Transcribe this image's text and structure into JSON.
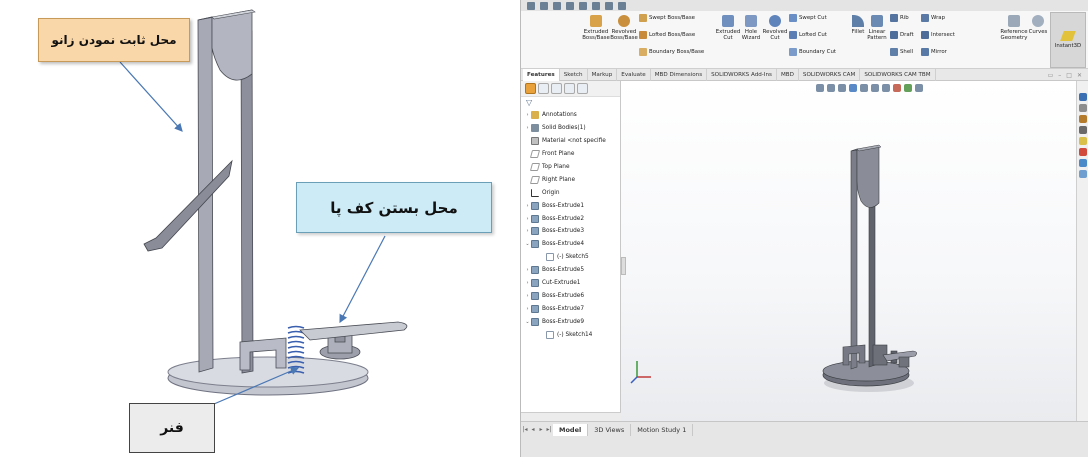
{
  "left_figure": {
    "callout_knee": "محل ثابت نمودن زانو",
    "callout_foot": "محل بستن کف پا",
    "callout_spring": "فنر"
  },
  "solidworks": {
    "ribbon": {
      "extruded_boss": "Extruded\nBoss/Base",
      "revolved_boss": "Revolved\nBoss/Base",
      "swept_boss": "Swept Boss/Base",
      "lofted_boss": "Lofted Boss/Base",
      "boundary_boss": "Boundary Boss/Base",
      "extruded_cut": "Extruded\nCut",
      "hole_wizard": "Hole\nWizard",
      "revolved_cut": "Revolved\nCut",
      "swept_cut": "Swept Cut",
      "lofted_cut": "Lofted Cut",
      "boundary_cut": "Boundary Cut",
      "fillet": "Fillet",
      "linear_pattern": "Linear\nPattern",
      "rib": "Rib",
      "draft": "Draft",
      "shell": "Shell",
      "wrap": "Wrap",
      "intersect": "Intersect",
      "mirror": "Mirror",
      "reference_geometry": "Reference\nGeometry",
      "curves": "Curves",
      "instant3d": "Instant3D"
    },
    "command_tabs": [
      "Features",
      "Sketch",
      "Markup",
      "Evaluate",
      "MBD Dimensions",
      "SOLIDWORKS Add-Ins",
      "MBD",
      "SOLIDWORKS CAM",
      "SOLIDWORKS CAM TBM"
    ],
    "tree": [
      {
        "label": "Annotations",
        "kind": "ann",
        "arrow": "›",
        "indent": 1
      },
      {
        "label": "Solid Bodies(1)",
        "kind": "folder",
        "arrow": "›",
        "indent": 1
      },
      {
        "label": "Material <not specifie",
        "kind": "mat",
        "arrow": "",
        "indent": 1
      },
      {
        "label": "Front Plane",
        "kind": "plane",
        "arrow": "",
        "indent": 1
      },
      {
        "label": "Top Plane",
        "kind": "plane",
        "arrow": "",
        "indent": 1
      },
      {
        "label": "Right Plane",
        "kind": "plane",
        "arrow": "",
        "indent": 1
      },
      {
        "label": "Origin",
        "kind": "origin",
        "arrow": "",
        "indent": 1
      },
      {
        "label": "Boss-Extrude1",
        "kind": "feat",
        "arrow": "›",
        "indent": 1
      },
      {
        "label": "Boss-Extrude2",
        "kind": "feat",
        "arrow": "›",
        "indent": 1
      },
      {
        "label": "Boss-Extrude3",
        "kind": "feat",
        "arrow": "›",
        "indent": 1
      },
      {
        "label": "Boss-Extrude4",
        "kind": "feat",
        "arrow": "⌄",
        "indent": 1
      },
      {
        "label": "(-) Sketch5",
        "kind": "sketch",
        "arrow": "",
        "indent": 3
      },
      {
        "label": "Boss-Extrude5",
        "kind": "feat",
        "arrow": "›",
        "indent": 1
      },
      {
        "label": "Cut-Extrude1",
        "kind": "feat",
        "arrow": "›",
        "indent": 1
      },
      {
        "label": "Boss-Extrude6",
        "kind": "feat",
        "arrow": "›",
        "indent": 1
      },
      {
        "label": "Boss-Extrude7",
        "kind": "feat",
        "arrow": "›",
        "indent": 1
      },
      {
        "label": "Boss-Extrude9",
        "kind": "feat",
        "arrow": "⌄",
        "indent": 1
      },
      {
        "label": "(-) Sketch14",
        "kind": "sketch",
        "arrow": "",
        "indent": 3
      }
    ],
    "bottom_tabs": [
      "Model",
      "3D Views",
      "Motion Study 1"
    ]
  }
}
